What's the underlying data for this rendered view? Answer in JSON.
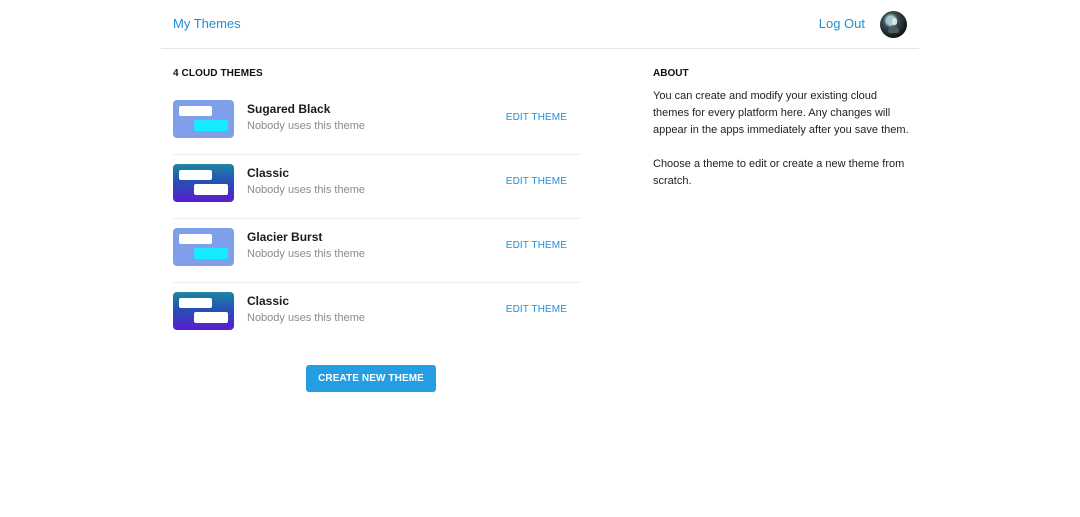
{
  "header": {
    "brand": "My Themes",
    "logout": "Log Out",
    "avatar_icon": "avatar-icon"
  },
  "themes": {
    "count_title": "4 CLOUD THEMES",
    "items": [
      {
        "name": "Sugared Black",
        "meta": "Nobody uses this theme",
        "action": "EDIT THEME",
        "thumb_style": "light"
      },
      {
        "name": "Classic",
        "meta": "Nobody uses this theme",
        "action": "EDIT THEME",
        "thumb_style": "dark"
      },
      {
        "name": "Glacier Burst",
        "meta": "Nobody uses this theme",
        "action": "EDIT THEME",
        "thumb_style": "light"
      },
      {
        "name": "Classic",
        "meta": "Nobody uses this theme",
        "action": "EDIT THEME",
        "thumb_style": "dark"
      }
    ],
    "create_label": "CREATE NEW THEME"
  },
  "about": {
    "title": "ABOUT",
    "paragraphs": [
      "You can create and modify your existing cloud themes for every platform here. Any changes will appear in the apps immediately after you save them.",
      "Choose a theme to edit or create a new theme from scratch."
    ]
  },
  "colors": {
    "accent": "#1f8fd8",
    "button": "#249de2",
    "divider": "#e6e6e6",
    "muted_text": "#8b8b8b"
  }
}
